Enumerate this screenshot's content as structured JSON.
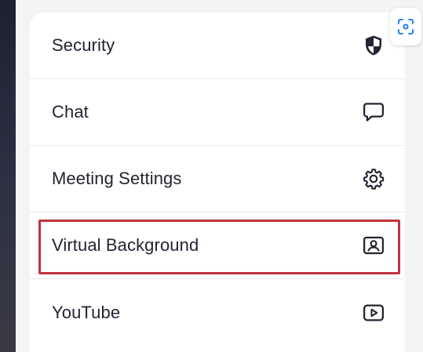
{
  "menu": {
    "items": [
      {
        "label": "Security",
        "icon": "shield-icon"
      },
      {
        "label": "Chat",
        "icon": "chat-bubble-icon"
      },
      {
        "label": "Meeting Settings",
        "icon": "gear-icon"
      },
      {
        "label": "Virtual Background",
        "icon": "portrait-icon",
        "highlighted": true
      },
      {
        "label": "YouTube",
        "icon": "youtube-play-icon"
      }
    ]
  },
  "colors": {
    "text": "#232333",
    "highlight_border": "#c0333f",
    "scan_accent": "#0e72ed"
  }
}
